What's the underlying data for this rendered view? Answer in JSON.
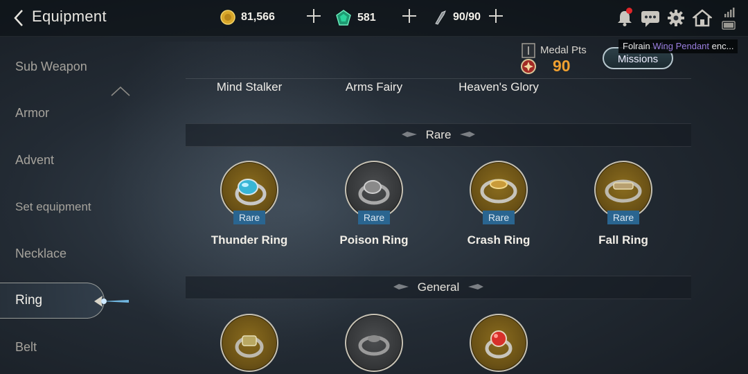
{
  "header": {
    "title": "Equipment",
    "gold": "81,566",
    "gems": "581",
    "stamina": "90/90"
  },
  "sidebar": {
    "items": [
      {
        "label": "Sub Weapon"
      },
      {
        "label": "Armor"
      },
      {
        "label": "Advent"
      },
      {
        "label": "Set equipment"
      },
      {
        "label": "Necklace"
      },
      {
        "label": "Ring"
      },
      {
        "label": "Belt"
      }
    ],
    "active": "Ring"
  },
  "medal": {
    "label": "Medal Pts",
    "value": "90"
  },
  "missions_label": "Missions",
  "tooltip": {
    "prefix": "Folrain ",
    "highlight": "Wing Pendant",
    "suffix": " enc..."
  },
  "top_items": [
    {
      "name": "Mind Stalker"
    },
    {
      "name": "Arms Fairy"
    },
    {
      "name": "Heaven's Glory"
    }
  ],
  "sections": [
    {
      "title": "Rare",
      "items": [
        {
          "name": "Thunder Ring",
          "rarity": "Rare",
          "gem": "#38b6d6"
        },
        {
          "name": "Poison Ring",
          "rarity": "Rare",
          "gem": "#9a9a9a"
        },
        {
          "name": "Crash Ring",
          "rarity": "Rare",
          "gem": "#c99b3a"
        },
        {
          "name": "Fall Ring",
          "rarity": "Rare",
          "gem": "#b8a070"
        }
      ]
    },
    {
      "title": "General",
      "items": [
        {
          "gem": "#b9a862"
        },
        {
          "gem": "#8a8a8a"
        },
        {
          "gem": "#d8302a"
        }
      ]
    }
  ],
  "colors": {
    "medal_value": "#f0a030",
    "rarity_badge": "#2a6590",
    "notification_dot": "#e0262a"
  },
  "icons": [
    "back-arrow-icon",
    "gold-coin-icon",
    "gem-icon",
    "stamina-icon",
    "bell-icon",
    "chat-icon",
    "gear-icon",
    "home-icon",
    "signal-battery-icon",
    "chevron-up-icon",
    "medal-icon"
  ]
}
